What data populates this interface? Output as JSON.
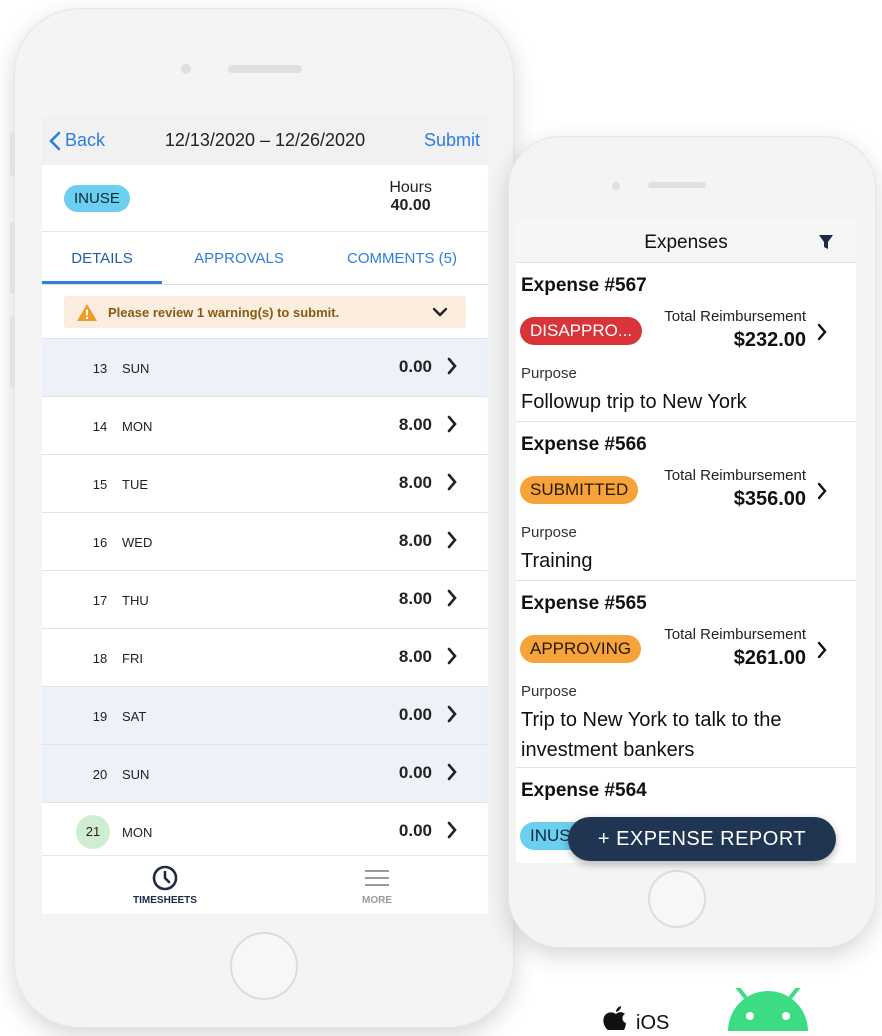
{
  "timesheet": {
    "nav": {
      "back_label": "Back",
      "title": "12/13/2020 – 12/26/2020",
      "submit_label": "Submit"
    },
    "status_badge": "INUSE",
    "hours_label": "Hours",
    "hours_value": "40.00",
    "tabs": [
      {
        "label": "DETAILS",
        "selected": true
      },
      {
        "label": "APPROVALS",
        "selected": false
      },
      {
        "label": "COMMENTS (5)",
        "selected": false
      }
    ],
    "warning_text": "Please review 1 warning(s) to submit.",
    "days": [
      {
        "num": "13",
        "dow": "SUN",
        "hours": "0.00",
        "weekend": true,
        "today": false
      },
      {
        "num": "14",
        "dow": "MON",
        "hours": "8.00",
        "weekend": false,
        "today": false
      },
      {
        "num": "15",
        "dow": "TUE",
        "hours": "8.00",
        "weekend": false,
        "today": false
      },
      {
        "num": "16",
        "dow": "WED",
        "hours": "8.00",
        "weekend": false,
        "today": false
      },
      {
        "num": "17",
        "dow": "THU",
        "hours": "8.00",
        "weekend": false,
        "today": false
      },
      {
        "num": "18",
        "dow": "FRI",
        "hours": "8.00",
        "weekend": false,
        "today": false
      },
      {
        "num": "19",
        "dow": "SAT",
        "hours": "0.00",
        "weekend": true,
        "today": false
      },
      {
        "num": "20",
        "dow": "SUN",
        "hours": "0.00",
        "weekend": true,
        "today": false
      },
      {
        "num": "21",
        "dow": "MON",
        "hours": "0.00",
        "weekend": false,
        "today": true
      }
    ],
    "tabbar": [
      {
        "label": "TIMESHEETS",
        "icon": "clock-icon",
        "active": true
      },
      {
        "label": "MORE",
        "icon": "menu-icon",
        "active": false
      }
    ]
  },
  "expenses": {
    "title": "Expenses",
    "filter_icon": "filter-icon",
    "total_label": "Total Reimbursement",
    "purpose_label": "Purpose",
    "items": [
      {
        "name": "Expense #567",
        "status": "DISAPPRO...",
        "status_bg": "#d8343a",
        "status_fg": "#ffffff",
        "amount": "$232.00",
        "purpose": "Followup trip to New York"
      },
      {
        "name": "Expense #566",
        "status": "SUBMITTED",
        "status_bg": "#f5a33a",
        "status_fg": "#2a1a05",
        "amount": "$356.00",
        "purpose": "Training"
      },
      {
        "name": "Expense #565",
        "status": "APPROVING",
        "status_bg": "#f5a33a",
        "status_fg": "#2a1a05",
        "amount": "$261.00",
        "purpose": "Trip to New York to talk to the investment bankers"
      },
      {
        "name": "Expense #564",
        "status": "INUSE",
        "status_bg": "#6ccff0",
        "status_fg": "#0b2a3a",
        "amount": "",
        "purpose": ""
      }
    ],
    "fab_label": "+ EXPENSE REPORT"
  },
  "logos": {
    "ios_label": "iOS",
    "android": "android-logo"
  },
  "colors": {
    "accent": "#2f7de1",
    "fab_bg": "#1f3552",
    "warning_bg": "#fbeede"
  }
}
